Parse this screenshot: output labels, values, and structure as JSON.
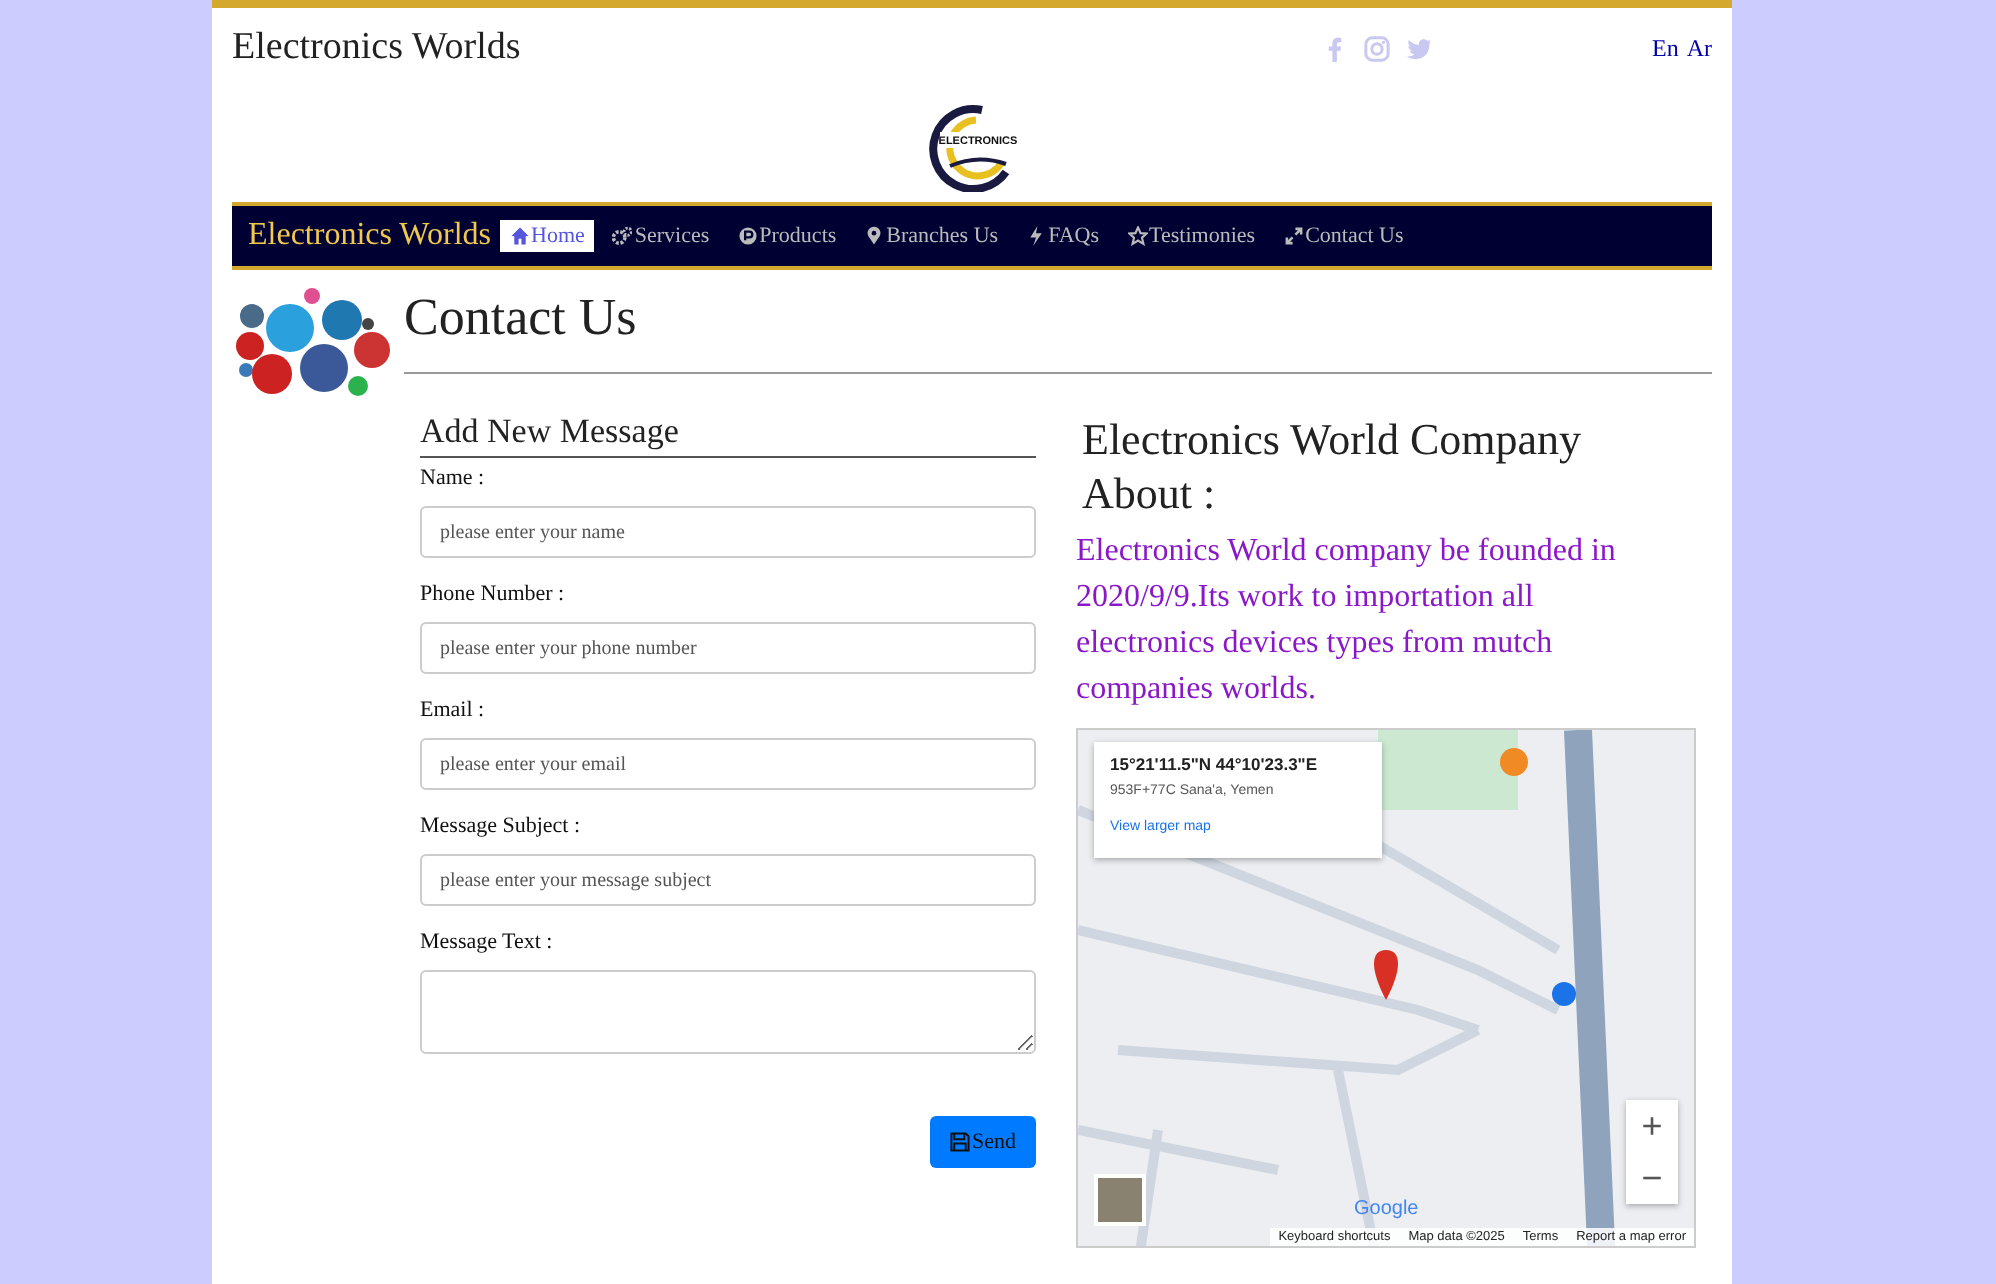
{
  "header": {
    "site_title": "Electronics Worlds",
    "languages": [
      "En",
      "Ar"
    ]
  },
  "logo": {
    "text": "ELECTRONICS"
  },
  "navbar": {
    "brand": "Electronics Worlds",
    "items": [
      {
        "label": "Home",
        "selected": true
      },
      {
        "label": "Services",
        "selected": false
      },
      {
        "label": "Products",
        "selected": false
      },
      {
        "label": "Branches Us",
        "selected": false
      },
      {
        "label": "FAQs",
        "selected": false
      },
      {
        "label": "Testimonies",
        "selected": false
      },
      {
        "label": "Contact Us",
        "selected": false
      }
    ]
  },
  "page_title": "Contact Us",
  "form": {
    "title": "Add New Message",
    "fields": [
      {
        "label": "Name :",
        "placeholder": "please enter your name",
        "kind": "input"
      },
      {
        "label": "Phone Number :",
        "placeholder": "please enter your phone number",
        "kind": "input"
      },
      {
        "label": "Email :",
        "placeholder": "please enter your email",
        "kind": "input"
      },
      {
        "label": "Message Subject :",
        "placeholder": "please enter your message subject",
        "kind": "input"
      },
      {
        "label": "Message Text :",
        "kind": "textarea"
      }
    ],
    "submit": "Send"
  },
  "about": {
    "title": "Electronics World Company About :",
    "text": "Electronics World company be founded in 2020/9/9.Its work to importation all electronics devices types from mutch companies worlds."
  },
  "map": {
    "coordinates": "15°21'11.5\"N 44°10'23.3\"E",
    "address": "953F+77C Sana'a, Yemen",
    "link": "View larger map",
    "zoom_in": "+",
    "zoom_out": "−",
    "brand": "Google",
    "footer": [
      "Keyboard shortcuts",
      "Map data ©2025",
      "Terms",
      "Report a map error"
    ]
  }
}
